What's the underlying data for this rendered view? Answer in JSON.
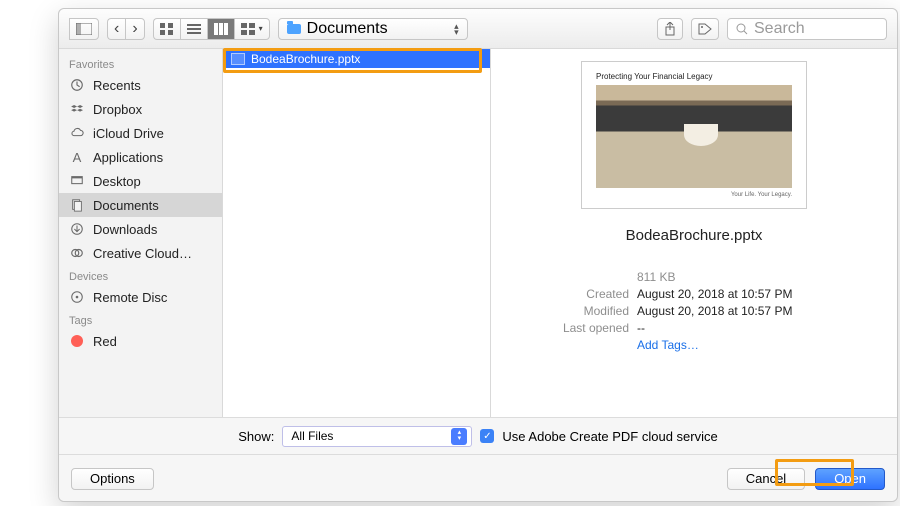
{
  "toolbar": {
    "current_folder": "Documents",
    "search_placeholder": "Search"
  },
  "sidebar": {
    "sections": [
      {
        "title": "Favorites",
        "items": [
          {
            "icon": "clock",
            "label": "Recents"
          },
          {
            "icon": "dropbox",
            "label": "Dropbox"
          },
          {
            "icon": "icloud",
            "label": "iCloud Drive"
          },
          {
            "icon": "apps",
            "label": "Applications"
          },
          {
            "icon": "desktop",
            "label": "Desktop"
          },
          {
            "icon": "documents",
            "label": "Documents",
            "selected": true
          },
          {
            "icon": "downloads",
            "label": "Downloads"
          },
          {
            "icon": "cc",
            "label": "Creative Cloud…"
          }
        ]
      },
      {
        "title": "Devices",
        "items": [
          {
            "icon": "disc",
            "label": "Remote Disc"
          }
        ]
      },
      {
        "title": "Tags",
        "items": [
          {
            "icon": "tag-red",
            "label": "Red"
          }
        ]
      }
    ]
  },
  "files": [
    {
      "name": "BodeaBrochure.pptx",
      "selected": true
    }
  ],
  "preview": {
    "name": "BodeaBrochure.pptx",
    "thumb_title": "Protecting Your Financial Legacy",
    "thumb_footer": "Your Life. Your Legacy.",
    "size": "811 KB",
    "meta": [
      {
        "label": "Created",
        "value": "August 20, 2018 at 10:57 PM"
      },
      {
        "label": "Modified",
        "value": "August 20, 2018 at 10:57 PM"
      },
      {
        "label": "Last opened",
        "value": "--"
      }
    ],
    "add_tags": "Add Tags…"
  },
  "show": {
    "label": "Show:",
    "format": "All Files",
    "cloud_label": "Use Adobe Create PDF cloud service",
    "cloud_checked": true
  },
  "footer": {
    "options": "Options",
    "cancel": "Cancel",
    "open": "Open"
  }
}
